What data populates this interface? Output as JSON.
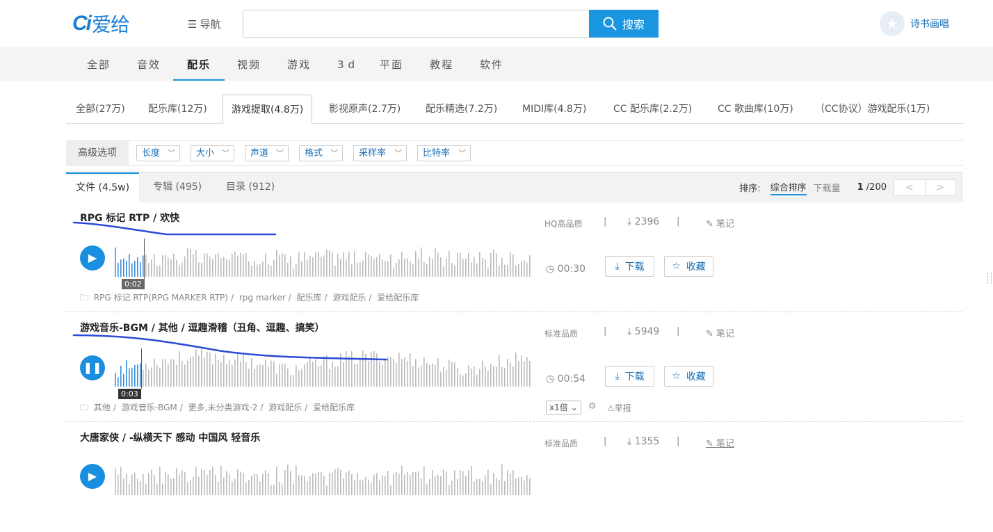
{
  "header": {
    "logo_mark": "Ci",
    "logo_text": "爱给",
    "nav_label": "导航",
    "search_value": "",
    "search_button": "搜索",
    "user_name": "诗书画唱"
  },
  "category_tabs": [
    "全部",
    "音效",
    "配乐",
    "视频",
    "游戏",
    "3d",
    "平面",
    "教程",
    "软件"
  ],
  "category_active": "配乐",
  "sub_tabs": [
    "全部(27万)",
    "配乐库(12万)",
    "游戏提取(4.8万)",
    "影视原声(2.7万)",
    "配乐精选(7.2万)",
    "MIDI库(4.8万)",
    "CC 配乐库(2.2万)",
    "CC 歌曲库(10万)",
    "（CC协议）游戏配乐(1万)"
  ],
  "sub_active": "游戏提取(4.8万)",
  "filters": {
    "label": "高级选项",
    "dropdowns": [
      "长度",
      "大小",
      "声道",
      "格式",
      "采样率",
      "比特率"
    ]
  },
  "result_tabs": [
    "文件 (4.5w)",
    "专辑 (495)",
    "目录 (912)"
  ],
  "sort": {
    "label": "排序:",
    "options": [
      "综合排序",
      "下载量"
    ],
    "page_current": "1",
    "page_total": "/200",
    "prev": "<",
    "next": ">"
  },
  "items": [
    {
      "title": "RPG 标记 RTP / 欢快",
      "time_badge": "0:02",
      "crumbs": [
        "RPG 标记 RTP(RPG MARKER RTP)",
        "rpg marker",
        "配乐库",
        "游戏配乐",
        "爱给配乐库"
      ],
      "quality": "HQ高品质",
      "downloads": "2396",
      "note": "笔记",
      "duration": "00:30",
      "download_btn": "下载",
      "fav_btn": "收藏",
      "playing": false,
      "progress": 0.07
    },
    {
      "title": "游戏音乐-BGM / 其他 / 逗趣滑稽（丑角、逗趣、搞笑）",
      "time_badge": "0:03",
      "crumbs": [
        "其他",
        "游戏音乐-BGM",
        "更多,未分类游戏-2",
        "游戏配乐",
        "爱给配乐库"
      ],
      "quality": "标准品质",
      "downloads": "5949",
      "note": "笔记",
      "duration": "00:54",
      "download_btn": "下载",
      "fav_btn": "收藏",
      "playing": true,
      "progress": 0.065,
      "speed": "x1倍",
      "report": "举报"
    },
    {
      "title": "大唐家侠 / -纵横天下 感动 中国风 轻音乐",
      "quality": "标准品质",
      "downloads": "1355",
      "note": "笔记"
    }
  ],
  "colors": {
    "accent": "#1a95e0",
    "link": "#1a6fb5",
    "annotation": "#2d4bd6"
  }
}
